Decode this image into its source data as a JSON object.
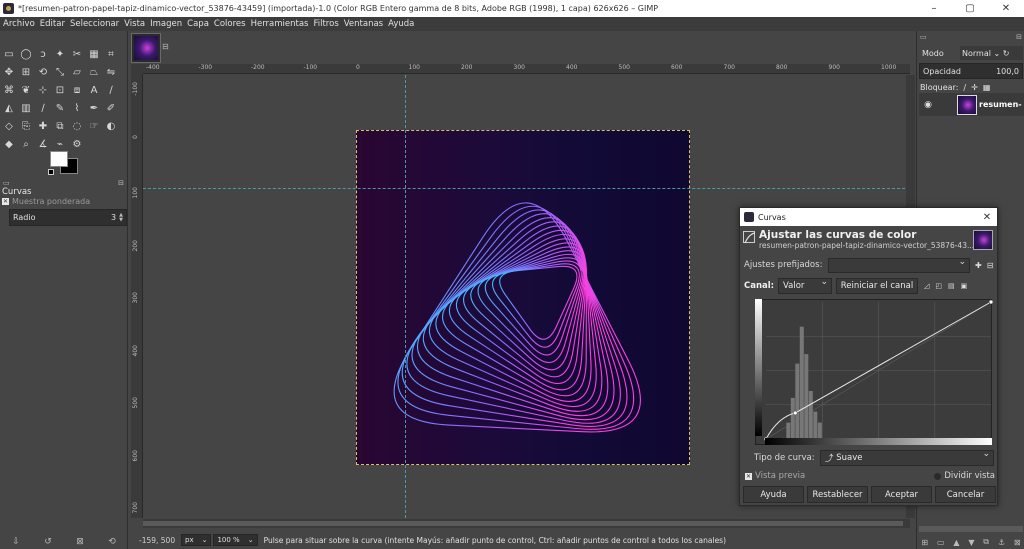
{
  "window": {
    "title": "*[resumen-patron-papel-tapiz-dinamico-vector_53876-43459] (importada)-1.0 (Color RGB Entero gamma de 8 bits, Adobe RGB (1998), 1 capa) 626x626 – GIMP",
    "minimize": "–",
    "maximize": "▢",
    "close": "✕"
  },
  "menu": [
    "Archivo",
    "Editar",
    "Seleccionar",
    "Vista",
    "Imagen",
    "Capa",
    "Colores",
    "Herramientas",
    "Filtros",
    "Ventanas",
    "Ayuda"
  ],
  "toolbox": {
    "icons": [
      "rect-select-icon",
      "ellipse-select-icon",
      "lasso-icon",
      "fuzzy-select-icon",
      "scissors-icon",
      "foreground-select-icon",
      "crop-icon",
      "move-icon",
      "align-icon",
      "rotate-icon",
      "scale-icon",
      "shear-icon",
      "perspective-icon",
      "flip-icon",
      "cage-icon",
      "warp-icon",
      "handle-transform-icon",
      "unified-transform-icon",
      "3d-transform-icon",
      "text-icon",
      "color-picker-icon",
      "bucket-fill-icon",
      "gradient-icon",
      "paintbrush-icon",
      "pencil-icon",
      "airbrush-icon",
      "ink-icon",
      "mypaint-brush-icon",
      "eraser-icon",
      "clone-icon",
      "heal-icon",
      "perspective-clone-icon",
      "blur-icon",
      "smudge-icon",
      "dodge-burn-icon",
      "path-icon",
      "zoom-icon",
      "measure-icon",
      "paths-icon",
      "script-icon"
    ],
    "fg_color": "#ffffff",
    "bg_color": "#000000"
  },
  "tool_options": {
    "title": "Curvas",
    "sample_average": "Muestra ponderada",
    "radius_label": "Radio",
    "radius_value": "3"
  },
  "rulers": {
    "h_ticks": [
      "-400",
      "-300",
      "-200",
      "-100",
      "0",
      "100",
      "200",
      "300",
      "400",
      "500",
      "600",
      "700",
      "800",
      "900",
      "1000"
    ],
    "v_ticks": [
      "-100",
      "0",
      "100",
      "200",
      "300",
      "400",
      "500",
      "600",
      "700",
      "800"
    ]
  },
  "status": {
    "coords": "-159, 500",
    "unit": "px",
    "zoom": "100 %",
    "message": "Pulse para situar sobre la curva (intente Mayús: añadir punto de control, Ctrl: añadir puntos de control a todos los canales)"
  },
  "layers": {
    "mode_label": "Modo",
    "mode_value": "Normal",
    "opacity_label": "Opacidad",
    "opacity_value": "100,0",
    "lock_label": "Bloquear:",
    "layer_name": "resumen-"
  },
  "dialog": {
    "window_title": "Curvas",
    "heading": "Ajustar las curvas de color",
    "subtitle": "resumen-patron-papel-tapiz-dinamico-vector_53876-43...",
    "presets_label": "Ajustes prefijados:",
    "channel_label": "Canal:",
    "channel_value": "Valor",
    "reset_channel": "Reiniciar el canal",
    "curve_type_label": "Tipo de curva:",
    "curve_type_value": "Suave",
    "preview_label": "Vista previa",
    "split_view_label": "Dividir vista",
    "buttons": [
      "Ayuda",
      "Restablecer",
      "Aceptar",
      "Cancelar"
    ]
  },
  "curve": {
    "points": [
      [
        0,
        0
      ],
      [
        0.13,
        0.19
      ],
      [
        1,
        1
      ]
    ]
  }
}
